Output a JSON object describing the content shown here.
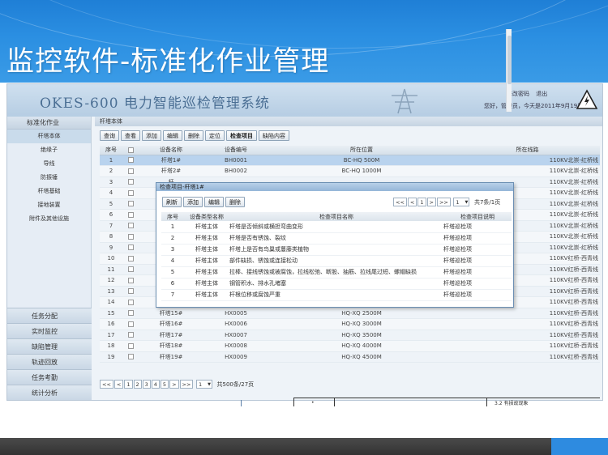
{
  "slide": {
    "title": "监控软件-标准化作业管理"
  },
  "app": {
    "title": "OKES-600  电力智能巡检管理系统",
    "links": [
      "修改密码",
      "退出"
    ],
    "user_info": "您好，管理员，今天是2011年9月19日。"
  },
  "sidebar": {
    "header": "标准化作业",
    "items": [
      "杆塔本体",
      "绝缘子",
      "导线",
      "防振锤",
      "杆塔基础",
      "接地装置",
      "附件及其他设施"
    ],
    "bottom_items": [
      "任务分配",
      "实时监控",
      "缺陷管理",
      "轨迹回放",
      "任务考勤",
      "统计分析"
    ]
  },
  "main": {
    "header": "杆塔本体",
    "toolbar": [
      "查询",
      "查看",
      "添加",
      "编辑",
      "删除",
      "定位",
      "检查项目",
      "缺陷内容"
    ],
    "columns": [
      "序号",
      "",
      "设备名称",
      "设备编号",
      "所在位置",
      "所在线路"
    ],
    "rows": [
      [
        "1",
        "杆塔1#",
        "BH0001",
        "BC-HQ 500M",
        "110KV北崇-红桥线"
      ],
      [
        "2",
        "杆塔2#",
        "BH0002",
        "BC-HQ 1000M",
        "110KV北崇-红桥线"
      ],
      [
        "3",
        "杆",
        "",
        "",
        "110KV北崇-红桥线"
      ],
      [
        "4",
        "杆",
        "",
        "",
        "110KV北崇-红桥线"
      ],
      [
        "5",
        "杆",
        "",
        "",
        "110KV北崇-红桥线"
      ],
      [
        "6",
        "杆",
        "",
        "",
        "110KV北崇-红桥线"
      ],
      [
        "7",
        "杆",
        "",
        "",
        "110KV北崇-红桥线"
      ],
      [
        "8",
        "杆",
        "",
        "",
        "110KV北崇-红桥线"
      ],
      [
        "9",
        "杆",
        "",
        "",
        "110KV北崇-红桥线"
      ],
      [
        "10",
        "杆",
        "",
        "",
        "110KV红桥-西青线"
      ],
      [
        "11",
        "杆",
        "",
        "",
        "110KV红桥-西青线"
      ],
      [
        "12",
        "杆",
        "",
        "",
        "110KV红桥-西青线"
      ],
      [
        "13",
        "杆",
        "",
        "",
        "110KV红桥-西青线"
      ],
      [
        "14",
        "杆塔14#",
        "HX0004",
        "HQ-XQ 2000M",
        "110KV红桥-西青线"
      ],
      [
        "15",
        "杆塔15#",
        "HX0005",
        "HQ-XQ 2500M",
        "110KV红桥-西青线"
      ],
      [
        "16",
        "杆塔16#",
        "HX0006",
        "HQ-XQ 3000M",
        "110KV红桥-西青线"
      ],
      [
        "17",
        "杆塔17#",
        "HX0007",
        "HQ-XQ 3500M",
        "110KV红桥-西青线"
      ],
      [
        "18",
        "杆塔18#",
        "HX0008",
        "HQ-XQ 4000M",
        "110KV红桥-西青线"
      ],
      [
        "19",
        "杆塔19#",
        "HX0009",
        "HQ-XQ 4500M",
        "110KV红桥-西青线"
      ]
    ],
    "pager": [
      "<<",
      "<",
      "1",
      "2",
      "3",
      "4",
      "5",
      ">",
      ">>"
    ],
    "page_size": "1",
    "total": "共500条/27页"
  },
  "dialog": {
    "title": "检查项目-杆塔1#",
    "toolbar": [
      "刷新",
      "添加",
      "编辑",
      "删除"
    ],
    "pager": [
      "<<",
      "<",
      "1",
      ">",
      ">>"
    ],
    "page_size": "1",
    "total": "共7条/1页",
    "columns": [
      "序号",
      "设备类型名称",
      "检查项目名称",
      "检查项目说明"
    ],
    "rows": [
      [
        "1",
        "杆塔主体",
        "杆塔是否倾斜或横担弯曲变形",
        "杆塔巡检项"
      ],
      [
        "2",
        "杆塔主体",
        "杆塔是否有锈蚀、裂纹",
        "杆塔巡检项"
      ],
      [
        "3",
        "杆塔主体",
        "杆塔上是否有鸟巢或蔓藤类植物",
        "杆塔巡检项"
      ],
      [
        "4",
        "杆塔主体",
        "部件缺损、锈蚀或连接松动",
        "杆塔巡检项"
      ],
      [
        "5",
        "杆塔主体",
        "拉棒、接线锈蚀或被腐蚀，拉线松弛、断股、抽筋、拉线尾过短、螺帽缺损",
        "杆塔巡检项"
      ],
      [
        "6",
        "杆塔主体",
        "钢管积水、排水孔堵塞",
        "杆塔巡检项"
      ],
      [
        "7",
        "杆塔主体",
        "杆根位移或腐蚀严重",
        "杆塔巡检项"
      ]
    ]
  },
  "fragment": {
    "text": "3.2 有损故现象",
    "dot": "•"
  },
  "colors": {
    "banner": "#2b8fe2",
    "selected_row": "#b9d3ee",
    "footer": "#3a3a3a",
    "footer_accent": "#2e8be0"
  }
}
